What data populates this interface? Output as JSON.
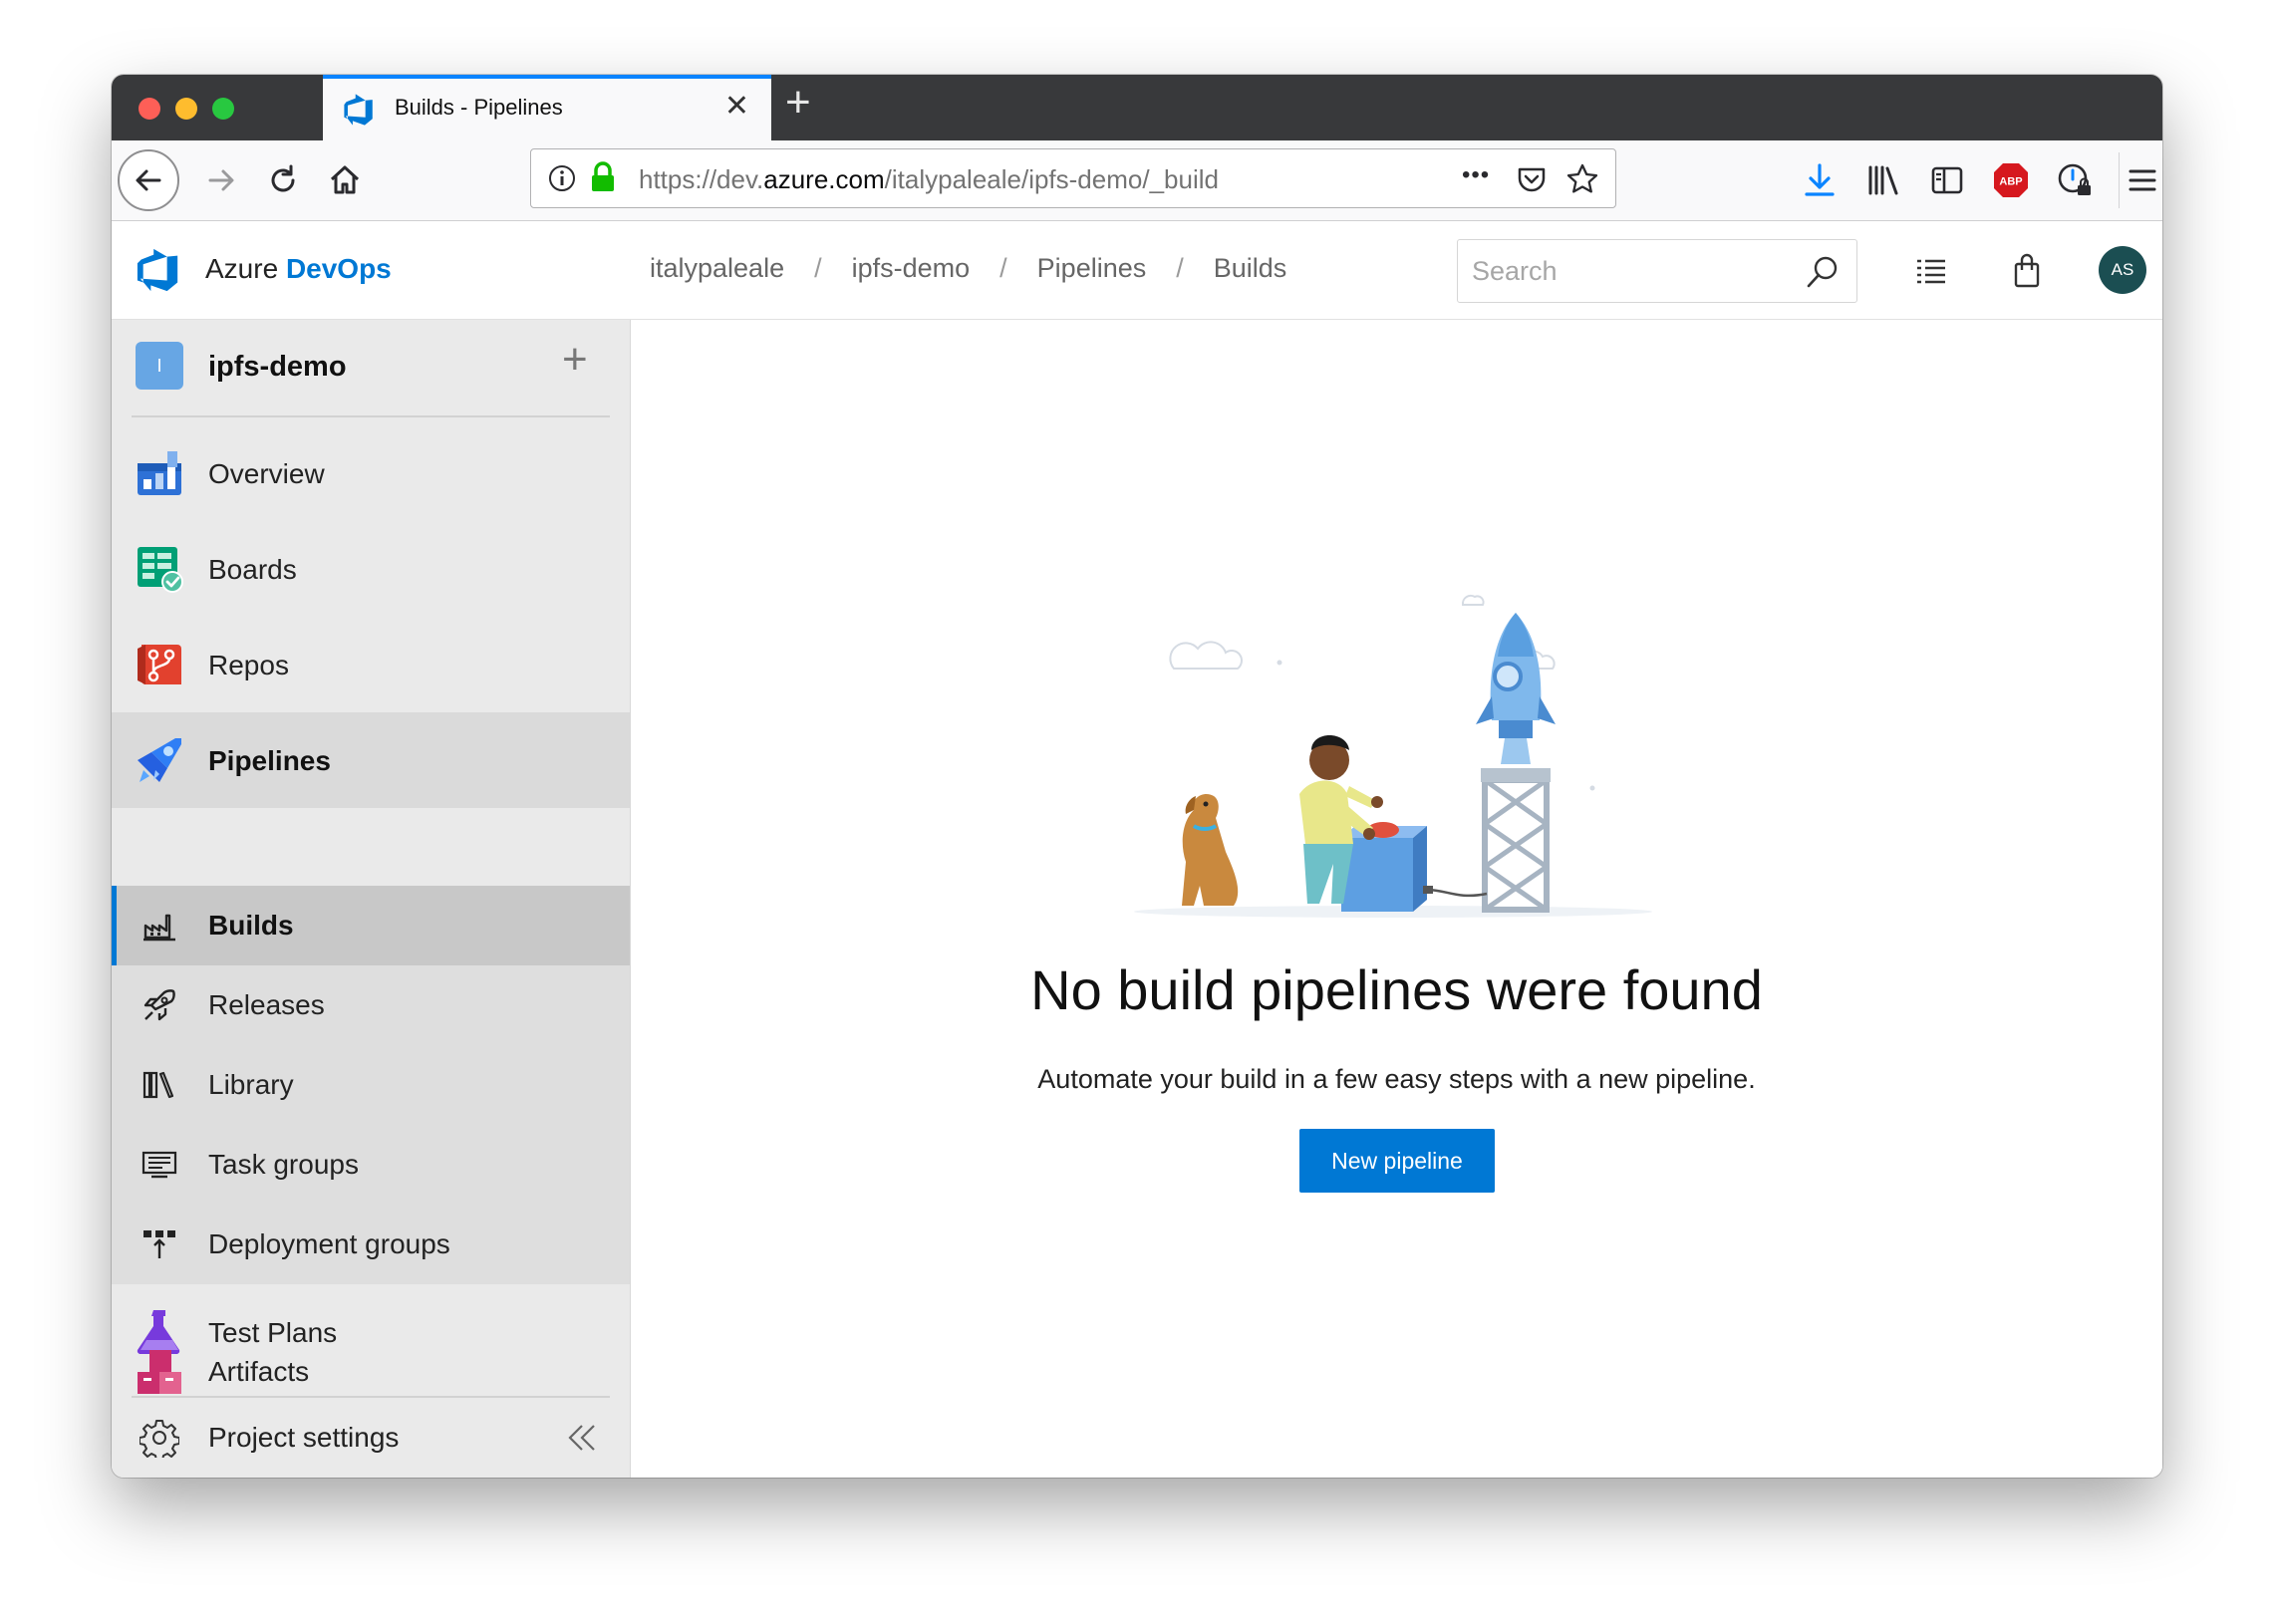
{
  "browser": {
    "tab_title": "Builds - Pipelines",
    "tab_close": "✕",
    "new_tab": "+",
    "url_prefix": "https://dev.",
    "url_host": "azure.com",
    "url_path": "/italypaleale/ipfs-demo/_build",
    "url_more": "•••",
    "abp_label": "ABP"
  },
  "header": {
    "brand_prefix": "Azure ",
    "brand_highlight": "DevOps",
    "breadcrumb": [
      "italypaleale",
      "ipfs-demo",
      "Pipelines",
      "Builds"
    ],
    "breadcrumb_separator": "/",
    "search_placeholder": "Search",
    "avatar_initials": "AS"
  },
  "sidebar": {
    "project_initial": "I",
    "project_name": "ipfs-demo",
    "project_add": "+",
    "items": [
      {
        "label": "Overview",
        "icon": "overview-icon"
      },
      {
        "label": "Boards",
        "icon": "boards-icon"
      },
      {
        "label": "Repos",
        "icon": "repos-icon"
      },
      {
        "label": "Pipelines",
        "icon": "pipelines-icon",
        "selected": true
      }
    ],
    "pipeline_subitems": [
      {
        "label": "Builds",
        "icon": "builds-icon",
        "active": true
      },
      {
        "label": "Releases",
        "icon": "releases-icon"
      },
      {
        "label": "Library",
        "icon": "library-icon"
      },
      {
        "label": "Task groups",
        "icon": "task-groups-icon"
      },
      {
        "label": "Deployment groups",
        "icon": "deployment-groups-icon"
      }
    ],
    "lower_items": [
      {
        "label": "Test Plans",
        "icon": "test-plans-icon"
      },
      {
        "label": "Artifacts",
        "icon": "artifacts-icon"
      }
    ],
    "settings_label": "Project settings"
  },
  "main": {
    "empty_title": "No build pipelines were found",
    "empty_description": "Automate your build in a few easy steps with a new pipeline.",
    "new_pipeline_label": "New pipeline"
  },
  "colors": {
    "accent": "#0078d4",
    "tab_indicator": "#0a84ff",
    "avatar_bg": "#1b4e52",
    "project_badge": "#67a6e4"
  }
}
